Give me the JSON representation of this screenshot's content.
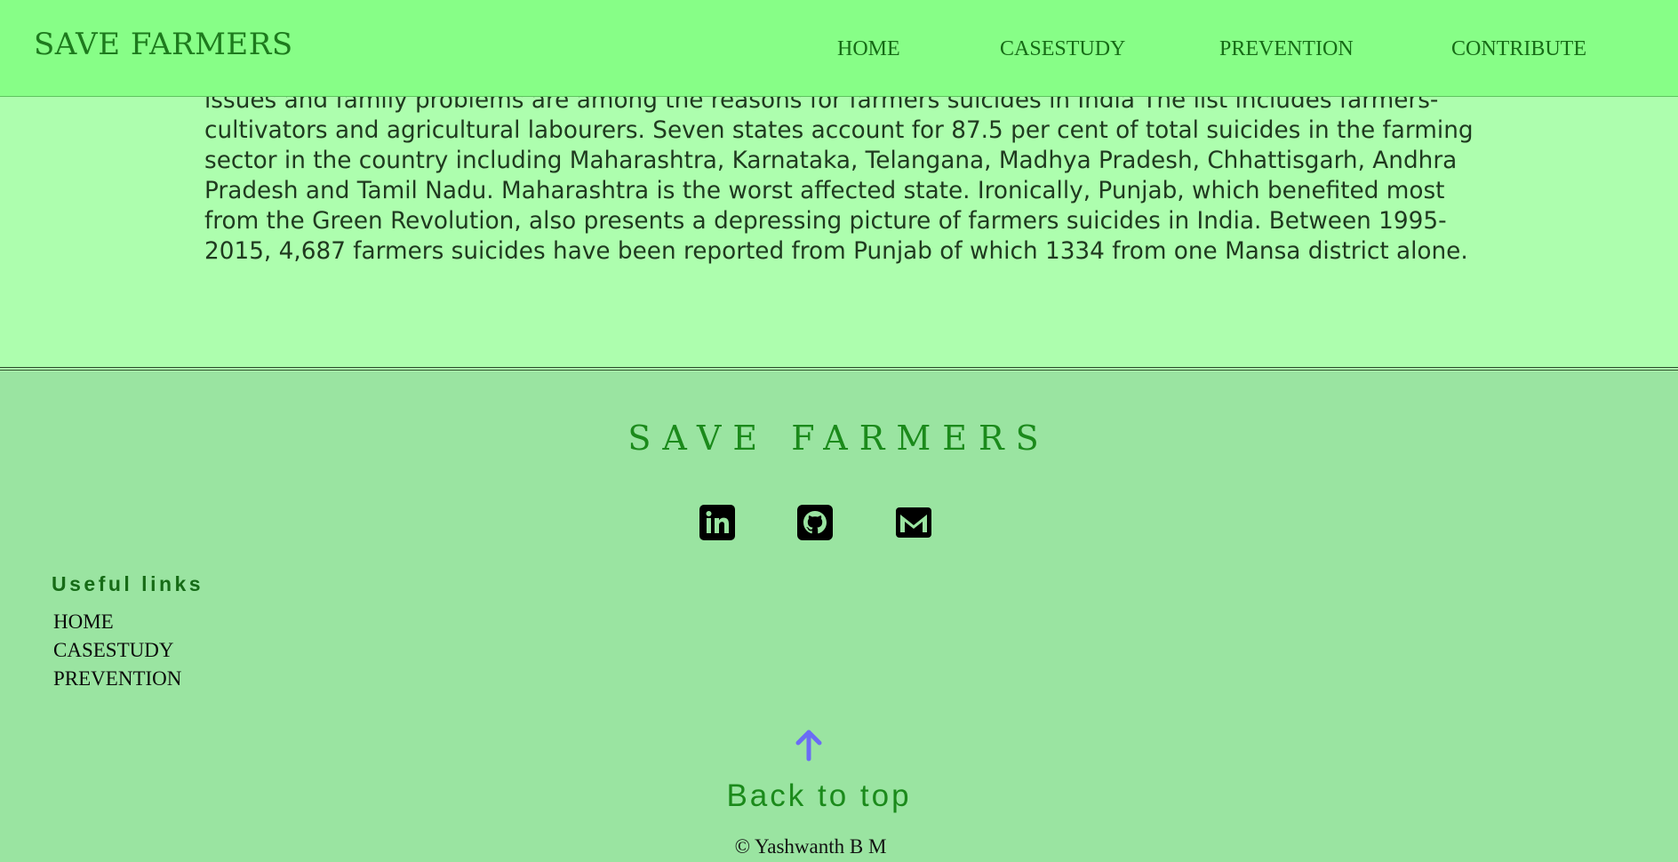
{
  "header": {
    "brand": "SAVE FARMERS",
    "nav": {
      "home": "HOME",
      "casestudy": "CASESTUDY",
      "prevention": "PREVENTION",
      "contribute": "CONTRIBUTE"
    }
  },
  "article": {
    "lines": [
      "issues and family problems are among the reasons for farmers suicides in India The list includes farmers-",
      "cultivators and agricultural labourers. Seven states account for 87.5 per cent of total suicides in the farming",
      "sector in the country including Maharashtra, Karnataka, Telangana, Madhya Pradesh, Chhattisgarh, Andhra",
      "Pradesh and Tamil Nadu. Maharashtra is the worst affected state. Ironically, Punjab, which benefited most",
      "from the Green Revolution, also presents a depressing picture of farmers suicides in India. Between 1995-",
      "2015, 4,687 farmers suicides have been reported from Punjab of which 1334 from one Mansa district alone."
    ]
  },
  "footer": {
    "brand": "SAVE FARMERS",
    "social": {
      "linkedin_icon": "linkedin-icon",
      "github_icon": "github-icon",
      "mail_icon": "mail-icon"
    },
    "useful_links": {
      "title": "Useful links",
      "items": [
        "HOME",
        "CASESTUDY",
        "PREVENTION"
      ]
    },
    "back_to_top": {
      "icon": "arrow-up-icon",
      "label": "Back to top"
    },
    "copyright": "© Yashwanth B M"
  },
  "colors": {
    "header_bg": "#87fe87",
    "page_bg": "#adfeae",
    "footer_bg": "#9ae4a1",
    "brand_green": "#1b8a1b",
    "arrow_blue": "#6b6cf5"
  }
}
